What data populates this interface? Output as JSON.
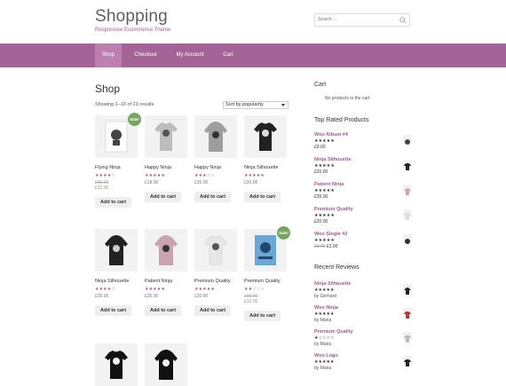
{
  "header": {
    "title": "Shopping",
    "tagline": "Responsive Ecommerce Theme",
    "search_placeholder": "Search …"
  },
  "nav": {
    "items": [
      {
        "label": "Shop",
        "active": true
      },
      {
        "label": "Checkout"
      },
      {
        "label": "My Account"
      },
      {
        "label": "Cart"
      }
    ]
  },
  "main": {
    "heading": "Shop",
    "result_count": "Showing 1–10 of 23 results",
    "sort_selected": "Sort by popularity",
    "products": [
      {
        "name": "Flying Ninja",
        "rating_stars": "★★★★☆",
        "price_old": "£15.00",
        "price": "£12.00",
        "sale_label": "Sale!",
        "button": "Add to cart"
      },
      {
        "name": "Happy Ninja",
        "rating_stars": "★★★★★",
        "price": "£18.00",
        "button": "Add to cart"
      },
      {
        "name": "Happy Ninja",
        "rating_stars": "★★★☆☆",
        "price": "£35.00",
        "button": "Add to cart"
      },
      {
        "name": "Ninja Silhouette",
        "rating_stars": "★★★★★",
        "price": "£20.00",
        "button": "Add to cart"
      },
      {
        "name": "Ninja Silhouette",
        "rating_stars": "★★★★☆",
        "price": "£35.00",
        "button": "Add to cart"
      },
      {
        "name": "Patient Ninja",
        "rating_stars": "★★★★★",
        "price": "£35.00",
        "button": "Add to cart"
      },
      {
        "name": "Premium Quality",
        "rating_stars": "★★★★★",
        "price": "£20.00",
        "button": "Add to cart"
      },
      {
        "name": "Premium Quality",
        "rating_stars": "★★☆☆☆",
        "price_old": "£15.00",
        "price": "£12.00",
        "sale_label": "Sale!",
        "button": "Add to cart"
      }
    ]
  },
  "sidebar": {
    "cart_title": "Cart",
    "cart_empty": "No products in the cart.",
    "top_rated_title": "Top Rated Products",
    "top_rated": [
      {
        "title": "Woo Album #4",
        "stars": "★★★★★",
        "price": "£9.00"
      },
      {
        "title": "Ninja Silhouette",
        "stars": "★★★★★",
        "price": "£20.00"
      },
      {
        "title": "Patient Ninja",
        "stars": "★★★★★",
        "price": "£35.00"
      },
      {
        "title": "Premium Quality",
        "stars": "★★★★★",
        "price": "£20.00"
      },
      {
        "title": "Woo Single #2",
        "stars": "★★★★★",
        "price_old": "£3.00",
        "price": "£2.00"
      }
    ],
    "reviews_title": "Recent Reviews",
    "reviews": [
      {
        "title": "Ninja Silhouette",
        "stars": "★★★★★",
        "by": "by Gerhard"
      },
      {
        "title": "Woo Ninja",
        "stars": "★★★★★",
        "by": "by Maria"
      },
      {
        "title": "Premium Quality",
        "stars": "★☆☆☆☆",
        "by": "by Maria"
      },
      {
        "title": "Woo Logo",
        "stars": "★★★★★",
        "by": "by Maria"
      }
    ]
  },
  "colors": {
    "accent": "#a46497",
    "nav_active": "#bb7fb0",
    "sale_green": "#77a464",
    "title_gray": "#5f5f5f"
  }
}
